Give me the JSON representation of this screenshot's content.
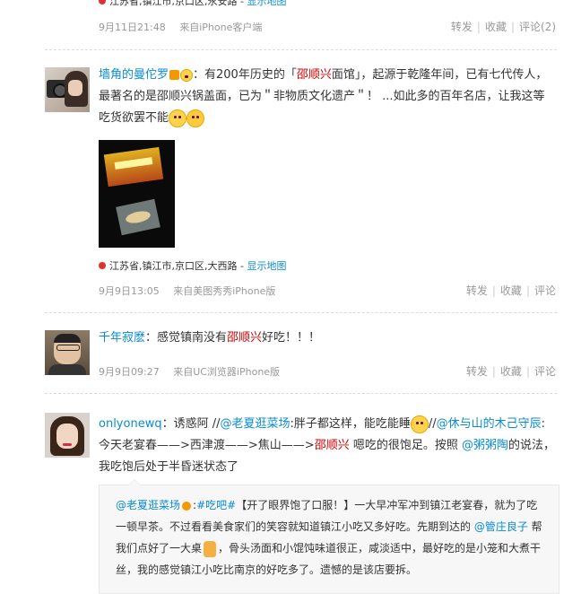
{
  "post0": {
    "location": "江苏省,镇江市,京口区,永安路",
    "show_map": "显示地图",
    "time": "9月11日21:48",
    "source": "来自iPhone客户端",
    "repost": "转发",
    "favorite": "收藏",
    "comment": "评论(2)"
  },
  "post1": {
    "author": "墙角的曼佗罗",
    "text_a": "：有200年历史的「",
    "highlight": "邵顺兴",
    "text_b": "面馆」，起源于乾隆年间，已有七代传人，最著名的是邵顺兴锅盖面，已为＂非物质文化遗产＂！ ...如此多的百年名店，让我这等吃货欲罢不能",
    "location": "江苏省,镇江市,京口区,大西路",
    "show_map": "显示地图",
    "time": "9月9日13:05",
    "source": "来自美图秀秀iPhone版",
    "repost": "转发",
    "favorite": "收藏",
    "comment": "评论"
  },
  "post2": {
    "author": "千年寂麽",
    "text_a": "：感觉镇南没有",
    "highlight": "邵顺兴",
    "text_b": "好吃！！！",
    "time": "9月9日09:27",
    "source": "来自UC浏览器iPhone版",
    "repost": "转发",
    "favorite": "收藏",
    "comment": "评论"
  },
  "post3": {
    "author": "onlyonewq",
    "text_a": "：诱惑阿 //",
    "mention1": "@老夏逛菜场",
    "text_b": ":胖子都这样，能吃能睡",
    "text_c": "//",
    "mention2": "@休与山的木己守辰",
    "text_d": ": 今天老宴春——>西津渡——>焦山——>",
    "highlight": "邵顺兴",
    "text_e": " 嗯吃的很饱足。按照 ",
    "mention3": "@粥粥陶",
    "text_f": "的说法，我吃饱后处于半昏迷状态了",
    "repost_author": "@老夏逛菜场",
    "repost_tag": "#吃吧#",
    "repost_text_a": "【开了眼界饱了口服！】一大早冲军冲到镇江老宴春，就为了吃一顿早茶。不过看看美食家们的笑容就知道镇江小吃又多好吃。先期到达的 ",
    "repost_mention": "@管庄良子",
    "repost_text_b": " 帮我们点好了一大桌",
    "repost_text_c": "，骨头汤面和小馄饨味道很正，咸淡适中，最好吃的是小笼和大煮干丝，我的感觉镇江小吃比南京的好吃多了。遗憾的是该店要拆。"
  }
}
